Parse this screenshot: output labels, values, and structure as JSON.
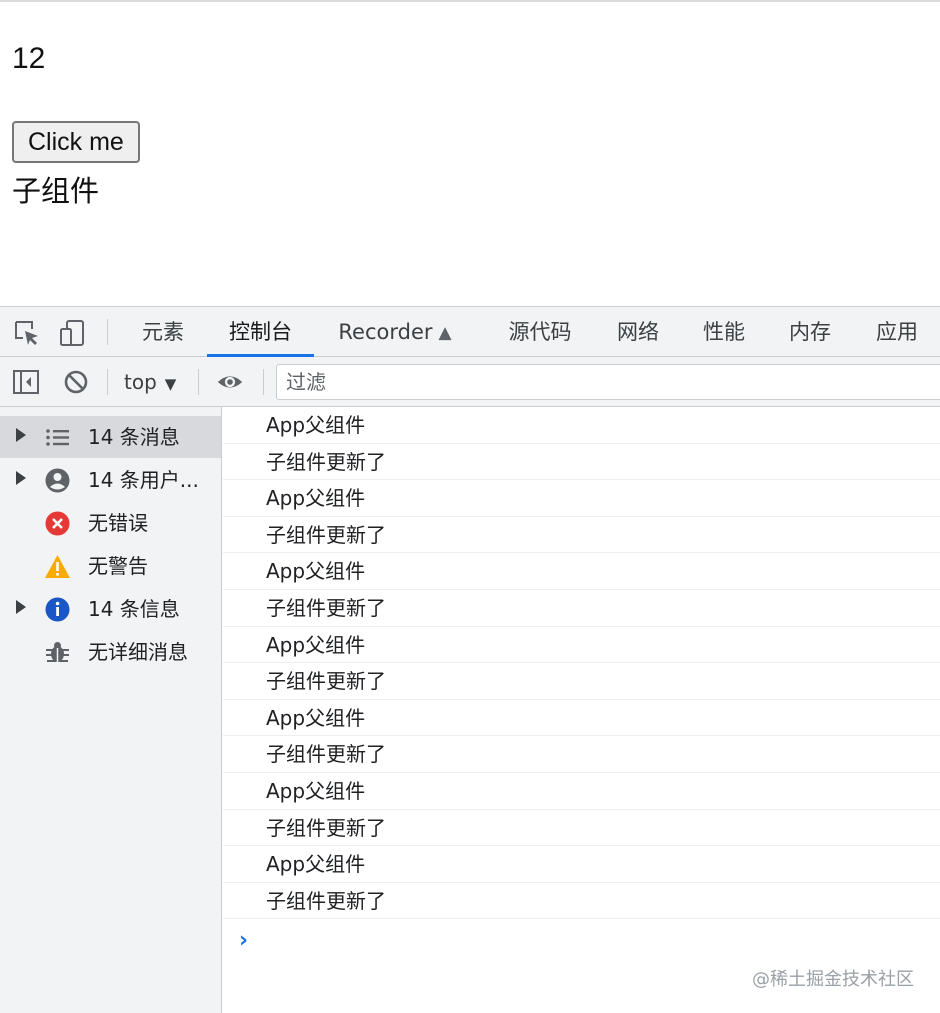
{
  "page": {
    "counter": "12",
    "button_label": "Click me",
    "child_text": "子组件"
  },
  "devtools": {
    "tabs": [
      {
        "label": "元素"
      },
      {
        "label": "控制台"
      },
      {
        "label": "Recorder"
      },
      {
        "label": "源代码"
      },
      {
        "label": "网络"
      },
      {
        "label": "性能"
      },
      {
        "label": "内存"
      },
      {
        "label": "应用"
      }
    ],
    "active_tab": "控制台",
    "recorder_icon": "flask-icon",
    "toolbar": {
      "context": "top",
      "filter_placeholder": "过滤"
    },
    "sidebar": [
      {
        "label": "14 条消息",
        "icon": "list-icon",
        "expandable": true,
        "selected": true
      },
      {
        "label": "14 条用户...",
        "icon": "user-icon",
        "expandable": true,
        "selected": false
      },
      {
        "label": "无错误",
        "icon": "error-icon",
        "expandable": false,
        "selected": false
      },
      {
        "label": "无警告",
        "icon": "warning-icon",
        "expandable": false,
        "selected": false
      },
      {
        "label": "14 条信息",
        "icon": "info-icon",
        "expandable": true,
        "selected": false
      },
      {
        "label": "无详细消息",
        "icon": "bug-icon",
        "expandable": false,
        "selected": false
      }
    ],
    "logs": [
      "App父组件",
      "子组件更新了",
      "App父组件",
      "子组件更新了",
      "App父组件",
      "子组件更新了",
      "App父组件",
      "子组件更新了",
      "App父组件",
      "子组件更新了",
      "App父组件",
      "子组件更新了",
      "App父组件",
      "子组件更新了"
    ],
    "prompt_symbol": "›"
  },
  "watermark": "@稀土掘金技术社区",
  "colors": {
    "accent": "#1a73e8",
    "error": "#e53935",
    "warning": "#f9ab00",
    "info": "#1a56c6"
  }
}
